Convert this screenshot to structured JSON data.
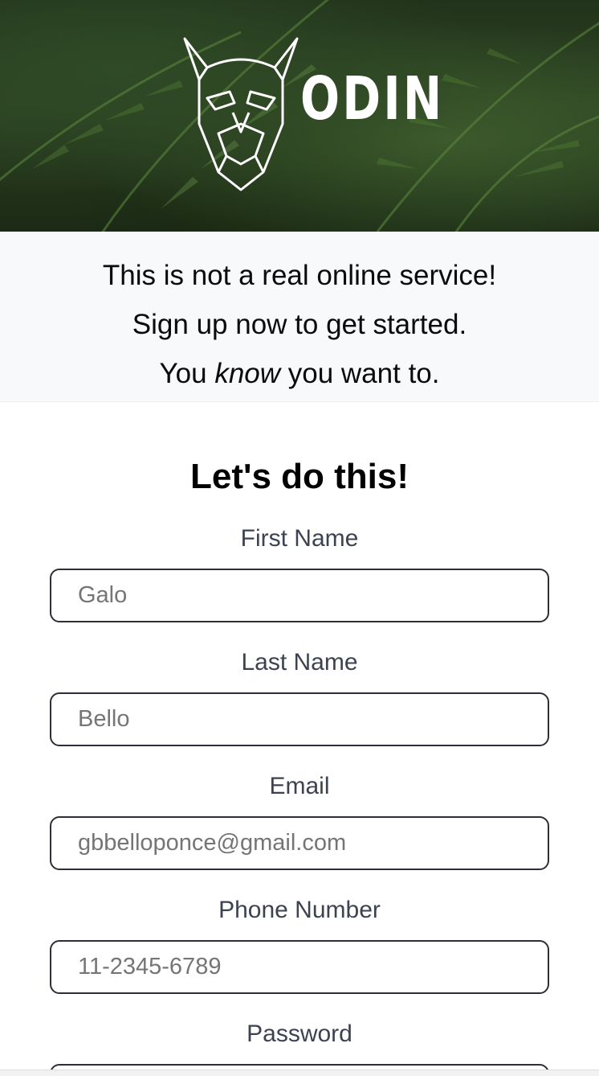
{
  "hero": {
    "logo_icon": "odin-viking-head-icon",
    "logo_text": "ODIN"
  },
  "intro": {
    "line1": "This is not a real online service!",
    "line2": "Sign up now to get started.",
    "line3_before": "You ",
    "line3_em": "know",
    "line3_after": " you want to."
  },
  "form": {
    "heading": "Let's do this!",
    "first_name": {
      "label": "First Name",
      "placeholder": "Galo"
    },
    "last_name": {
      "label": "Last Name",
      "placeholder": "Bello"
    },
    "email": {
      "label": "Email",
      "placeholder": "gbbelloponce@gmail.com"
    },
    "phone": {
      "label": "Phone Number",
      "placeholder": "11-2345-6789"
    },
    "password": {
      "label": "Password",
      "placeholder": ""
    }
  },
  "colors": {
    "intro_bg": "#f8f9fb",
    "label": "#3c4250",
    "input_border": "#2c2f36",
    "placeholder": "#6b6b6b"
  }
}
